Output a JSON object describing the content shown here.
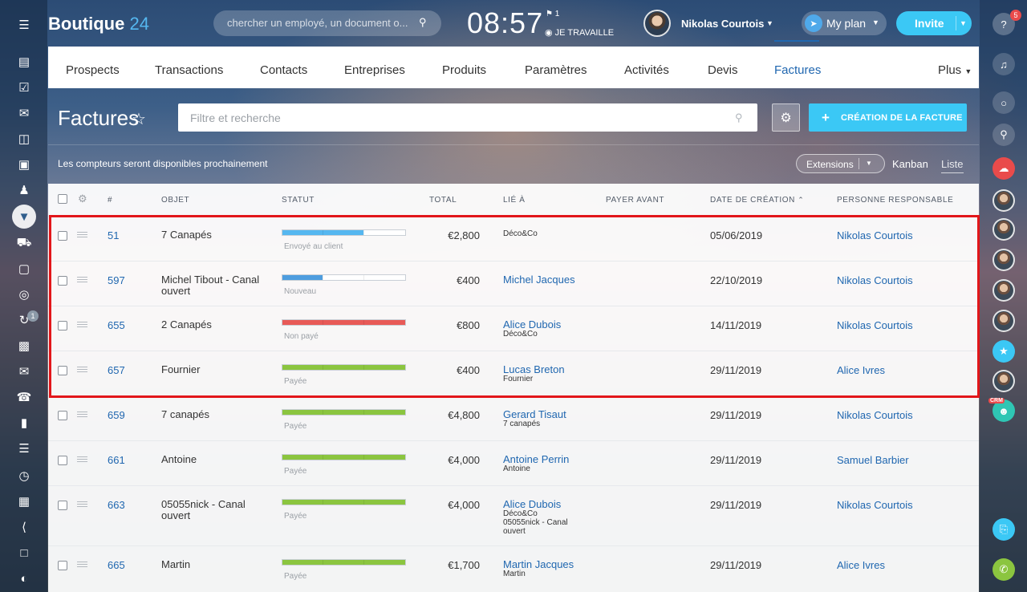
{
  "app": {
    "logo_name": "Boutique",
    "logo_num": "24",
    "search_placeholder": "chercher un employé, un document o...",
    "clock": "08:57",
    "flag_count": "1",
    "work_status": "JE TRAVAILLE",
    "user_name": "Nikolas Courtois",
    "myplan_label": "My plan",
    "invite_label": "Invite",
    "left_badge": "1",
    "right_badge": "5",
    "crm_tag": "CRM"
  },
  "tabs": [
    {
      "label": "Prospects"
    },
    {
      "label": "Transactions"
    },
    {
      "label": "Contacts"
    },
    {
      "label": "Entreprises"
    },
    {
      "label": "Produits"
    },
    {
      "label": "Paramètres"
    },
    {
      "label": "Activités"
    },
    {
      "label": "Devis"
    },
    {
      "label": "Factures",
      "active": true
    },
    {
      "label": "Plus"
    }
  ],
  "page": {
    "title": "Factures",
    "filter_placeholder": "Filtre et recherche",
    "create_label": "CRÉATION DE LA FACTURE",
    "notice": "Les compteurs seront disponibles prochainement",
    "extensions_label": "Extensions",
    "view_kanban": "Kanban",
    "view_liste": "Liste"
  },
  "table": {
    "headers": [
      "#",
      "OBJET",
      "STATUT",
      "TOTAL",
      "LIÉ À",
      "PAYER AVANT",
      "DATE DE CRÉATION",
      "PERSONNE RESPONSABLE"
    ],
    "rows": [
      {
        "id": "51",
        "object": "7 Canapés",
        "status": "Envoyé au client",
        "status_color": "#55b7f0",
        "progress": 0.66,
        "total": "€2,800",
        "linked": "",
        "linked_sub": "Déco&Co",
        "linked_sub2": "",
        "pay_before": "",
        "date": "05/06/2019",
        "responsible": "Nikolas Courtois"
      },
      {
        "id": "597",
        "object": "Michel Tibout - Canal ouvert",
        "status": "Nouveau",
        "status_color": "#4e9ddf",
        "progress": 0.33,
        "total": "€400",
        "linked": "Michel Jacques",
        "linked_sub": "",
        "linked_sub2": "",
        "pay_before": "",
        "date": "22/10/2019",
        "responsible": "Nikolas Courtois"
      },
      {
        "id": "655",
        "object": "2 Canapés",
        "status": "Non payé",
        "status_color": "#e85a57",
        "progress": 1.0,
        "total": "€800",
        "linked": "Alice Dubois",
        "linked_sub": "Déco&Co",
        "linked_sub2": "",
        "pay_before": "",
        "date": "14/11/2019",
        "responsible": "Nikolas Courtois"
      },
      {
        "id": "657",
        "object": "Fournier",
        "status": "Payée",
        "status_color": "#8bc53f",
        "progress": 1.0,
        "total": "€400",
        "linked": "Lucas Breton",
        "linked_sub": "Fournier",
        "linked_sub2": "",
        "pay_before": "",
        "date": "29/11/2019",
        "responsible": "Alice Ivres"
      },
      {
        "id": "659",
        "object": "7 canapés",
        "status": "Payée",
        "status_color": "#8bc53f",
        "progress": 1.0,
        "total": "€4,800",
        "linked": "Gerard Tisaut",
        "linked_sub": "7 canapés",
        "linked_sub2": "",
        "pay_before": "",
        "date": "29/11/2019",
        "responsible": "Nikolas Courtois"
      },
      {
        "id": "661",
        "object": "Antoine",
        "status": "Payée",
        "status_color": "#8bc53f",
        "progress": 1.0,
        "total": "€4,000",
        "linked": "Antoine Perrin",
        "linked_sub": "Antoine",
        "linked_sub2": "",
        "pay_before": "",
        "date": "29/11/2019",
        "responsible": "Samuel Barbier"
      },
      {
        "id": "663",
        "object": "05055nick - Canal ouvert",
        "status": "Payée",
        "status_color": "#8bc53f",
        "progress": 1.0,
        "total": "€4,000",
        "linked": "Alice Dubois",
        "linked_sub": "Déco&Co",
        "linked_sub2": "05055nick - Canal ouvert",
        "pay_before": "",
        "date": "29/11/2019",
        "responsible": "Nikolas Courtois"
      },
      {
        "id": "665",
        "object": "Martin",
        "status": "Payée",
        "status_color": "#8bc53f",
        "progress": 1.0,
        "total": "€1,700",
        "linked": "Martin Jacques",
        "linked_sub": "Martin",
        "linked_sub2": "",
        "pay_before": "",
        "date": "29/11/2019",
        "responsible": "Alice Ivres"
      }
    ]
  },
  "icons": {
    "left_sidebar": [
      "menu-icon",
      "feed-icon",
      "tasks-icon",
      "chat-icon",
      "drive-icon",
      "calendar-icon",
      "employees-icon",
      "crm-icon",
      "shop-icon",
      "sites-icon",
      "marketing-icon",
      "automation-icon",
      "contact-center-icon",
      "mail-icon",
      "telephony-icon",
      "analytics-icon",
      "settings-icon",
      "time-icon",
      "apps-icon",
      "developer-icon",
      "knowledge-icon",
      "moon-icon"
    ],
    "right_sidebar": [
      "help-icon",
      "notifications-icon",
      "open-lines-icon",
      "search-icon",
      "cloud-icon",
      "megaphone-icon",
      "crm-user-icon",
      "copy-icon",
      "call-icon"
    ]
  }
}
